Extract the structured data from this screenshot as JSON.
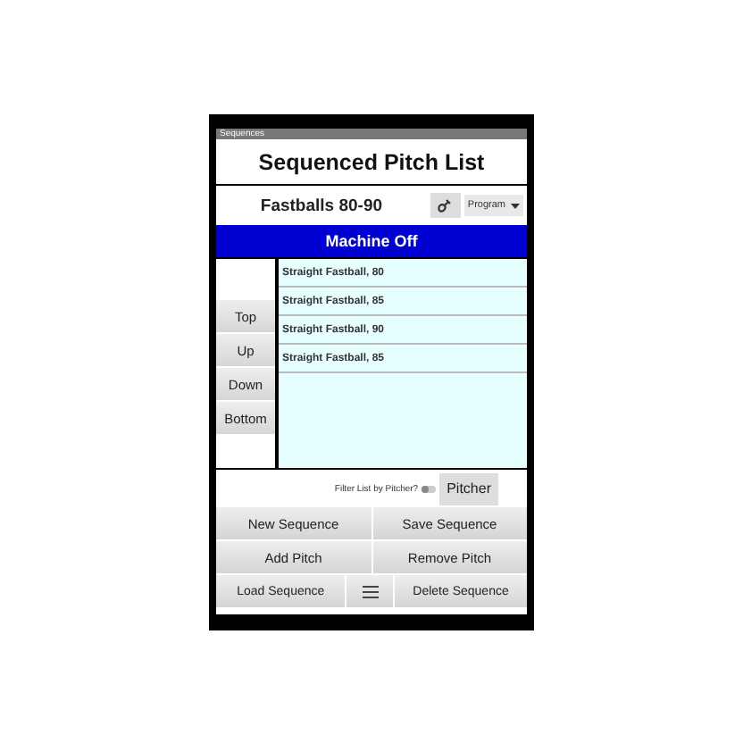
{
  "status_bar": {
    "title": "Sequences"
  },
  "header": {
    "title": "Sequenced Pitch List"
  },
  "sequence": {
    "name": "Fastballs 80-90",
    "mode": "Program"
  },
  "machine": {
    "status": "Machine Off"
  },
  "move_buttons": [
    "Top",
    "Up",
    "Down",
    "Bottom"
  ],
  "pitches": [
    {
      "label": "Straight Fastball, 80"
    },
    {
      "label": "Straight Fastball, 85"
    },
    {
      "label": "Straight Fastball, 90"
    },
    {
      "label": "Straight Fastball, 85"
    }
  ],
  "filter": {
    "label": "Filter List by Pitcher?",
    "on": false,
    "button": "Pitcher"
  },
  "actions": [
    {
      "kind": "text",
      "label": "New Sequence"
    },
    {
      "kind": "text",
      "label": "Save Sequence"
    },
    {
      "kind": "text",
      "label": "Add Pitch"
    },
    {
      "kind": "text",
      "label": "Remove Pitch"
    }
  ],
  "bottom_actions": [
    {
      "kind": "text",
      "label": "Load Sequence"
    },
    {
      "kind": "menu"
    },
    {
      "kind": "text",
      "label": "Delete Sequence"
    }
  ]
}
